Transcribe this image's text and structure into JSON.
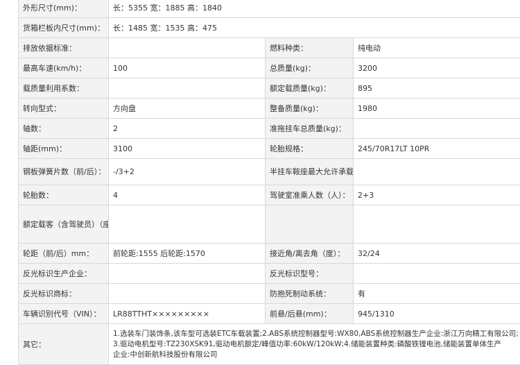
{
  "rows": [
    {
      "label": "外形尺寸(mm)：",
      "value": "长：5355 宽：1885 高：1840"
    },
    {
      "label": "货箱栏板内尺寸(mm)：",
      "value": "长：1485 宽：1535 高：475"
    },
    {
      "left_label": "排放依据标准：",
      "left_value": "",
      "right_label": "燃料种类：",
      "right_value": "纯电动"
    },
    {
      "left_label": "最高车速(km/h)：",
      "left_value": "100",
      "right_label": "总质量(kg)：",
      "right_value": "3200"
    },
    {
      "left_label": "载质量利用系数：",
      "left_value": "",
      "right_label": "额定载质量(kg)：",
      "right_value": "895"
    },
    {
      "left_label": "转向型式：",
      "left_value": "方向盘",
      "right_label": "整备质量(kg)：",
      "right_value": "1980"
    },
    {
      "left_label": "轴数：",
      "left_value": "2",
      "right_label": "准拖挂车总质量(kg)：",
      "right_value": ""
    },
    {
      "left_label": "轴距(mm)：",
      "left_value": "3100",
      "right_label": "轮胎规格：",
      "right_value": "245/70R17LT 10PR"
    },
    {
      "left_label": "钢板弹簧片数（前/后）：",
      "left_value": "-/3+2",
      "right_label": "半挂车鞍座最大允许承载质量(kg)：",
      "right_value": ""
    },
    {
      "left_label": "轮胎数：",
      "left_value": "4",
      "right_label": "驾驶室准乘人数（人）：",
      "right_value": "2+3"
    },
    {
      "left_label": "额定载客（含驾驶员）（座位数）：",
      "left_value": "",
      "right_label": "",
      "right_value": ""
    },
    {
      "left_label": "轮距（前/后）mm：",
      "left_value": "前轮距:1555 后轮距:1570",
      "right_label": "接近角/离去角（度）：",
      "right_value": "32/24"
    },
    {
      "left_label": "反光标识生产企业：",
      "left_value": "",
      "right_label": "反光标识型号：",
      "right_value": ""
    },
    {
      "left_label": "反光标识商标：",
      "left_value": "",
      "right_label": "防抱死制动系统：",
      "right_value": "有"
    },
    {
      "left_label": "车辆识别代号（VIN）：",
      "left_value": "LR88TTHT×××××××××",
      "right_label": "前悬/后悬(mm)：",
      "right_value": "945/1310"
    }
  ],
  "other": {
    "label": "其它：",
    "lines": [
      "1.选装车门装饰条,该车型可选装ETC车载装置;2.ABS系统控制器型号:WX80,ABS系统控制器生产企业:浙江万向精工有限公司;",
      "3.驱动电机型号:TZ230XSK91,驱动电机额定/峰值功率:60kW/120kW;4.储能装置种类:磷酸铁锂电池,储能装置单体生产",
      "企业:中创新航科技股份有限公司"
    ]
  }
}
